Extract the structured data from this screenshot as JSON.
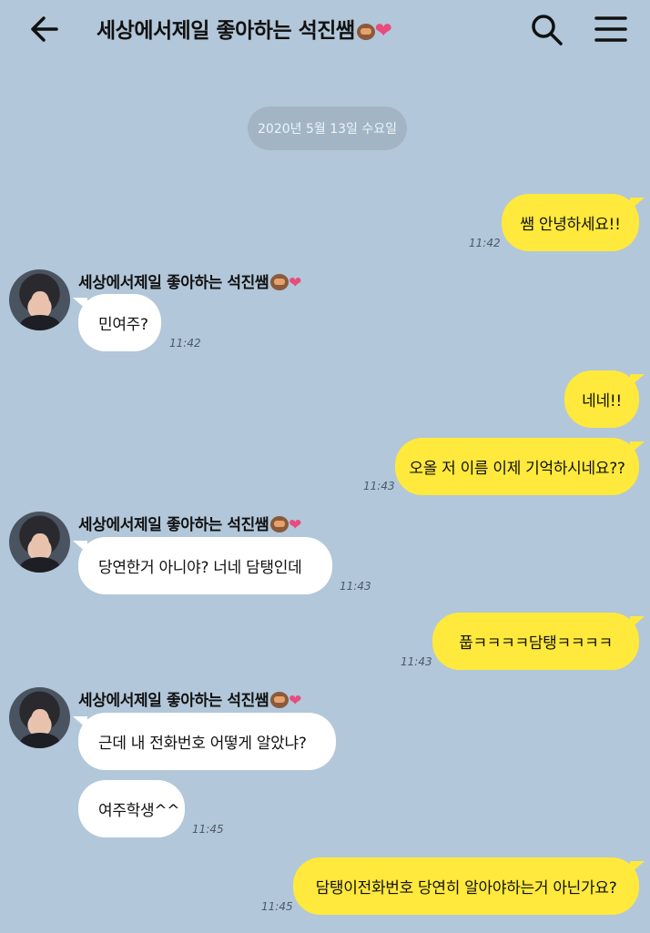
{
  "header": {
    "title": "세상에서제일 좋아하는 석진쌤",
    "heart": "❤"
  },
  "date_divider": "2020년 5월 13일 수요일",
  "contact": {
    "name": "세상에서제일 좋아하는 석진쌤",
    "heart": "❤"
  },
  "messages": [
    {
      "text": "쌤 안녕하세요!!",
      "time": "11:42"
    },
    {
      "text": "민여주?",
      "time": "11:42"
    },
    {
      "text": "네네!!",
      "time": ""
    },
    {
      "text": "오올 저 이름 이제 기억하시네요??",
      "time": "11:43"
    },
    {
      "text": "당연한거 아니야? 너네 담탱인데",
      "time": "11:43"
    },
    {
      "text": "풉ㅋㅋㅋㅋ담탱ㅋㅋㅋㅋ",
      "time": "11:43"
    },
    {
      "text": "근데 내 전화번호 어떻게 알았냐?",
      "time": ""
    },
    {
      "text": "여주학생^^",
      "time": "11:45"
    },
    {
      "text": "담탱이전화번호 당연히 알아야하는거 아닌가요?",
      "time": "11:45"
    }
  ],
  "colors": {
    "background": "#b2c7d9",
    "my_bubble": "#fee93c",
    "their_bubble": "#ffffff",
    "heart": "#e84b7d"
  }
}
